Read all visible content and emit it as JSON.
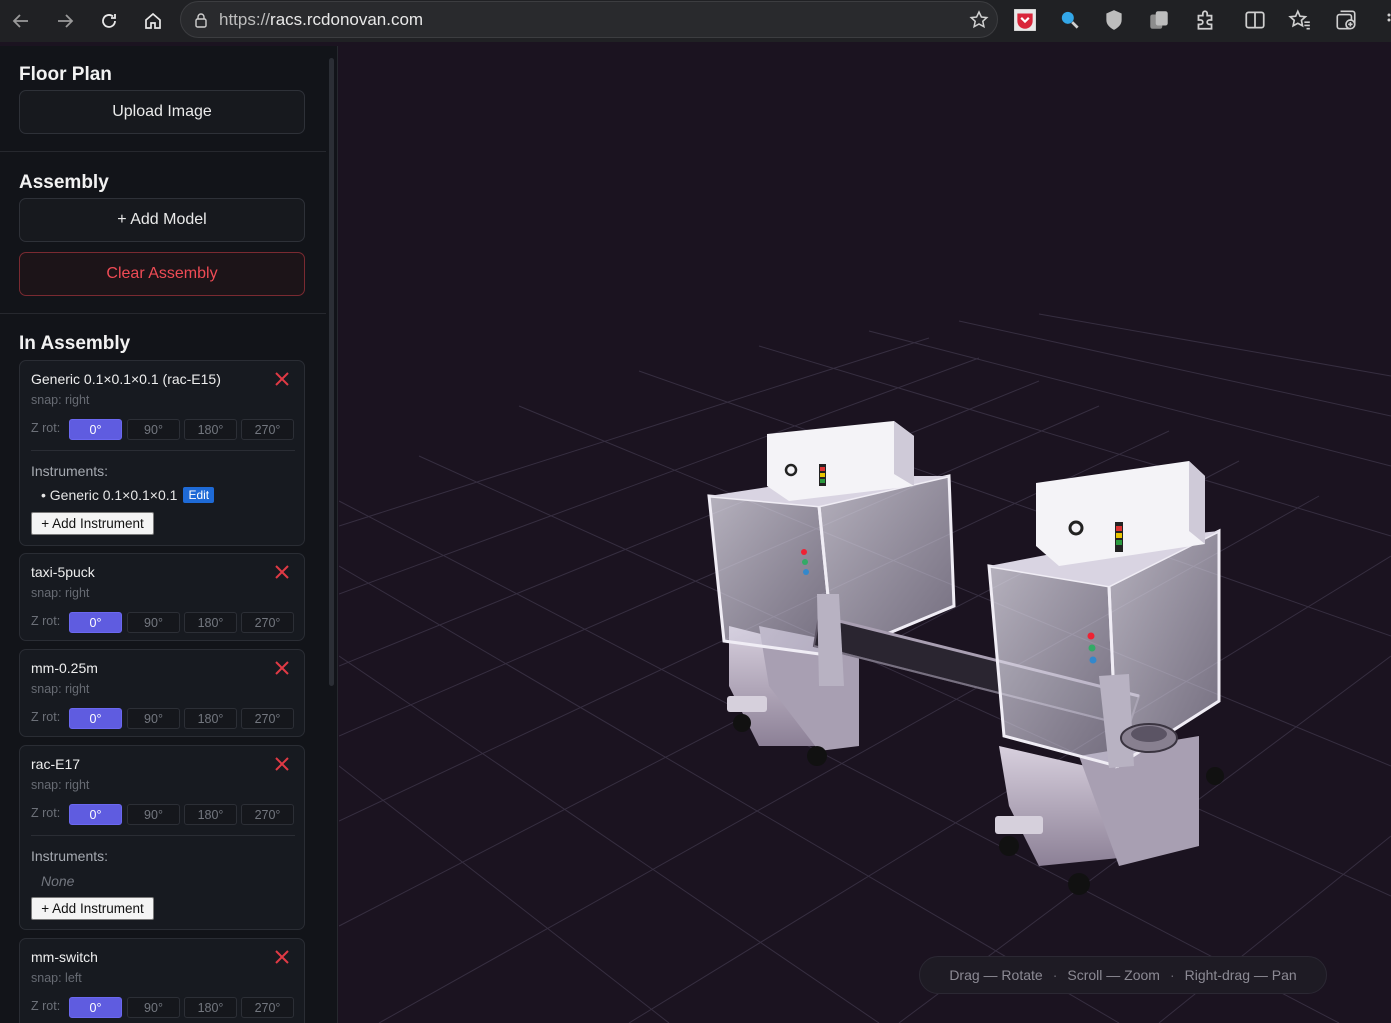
{
  "browser": {
    "url_protocol": "https://",
    "url_host": "racs.rcdonovan.com"
  },
  "sidebar": {
    "floor_plan": {
      "title": "Floor Plan",
      "upload_label": "Upload Image"
    },
    "assembly": {
      "title": "Assembly",
      "add_model_label": "+ Add Model",
      "clear_label": "Clear Assembly"
    },
    "in_assembly": {
      "title": "In Assembly",
      "rot_label": "Z rot:",
      "rot_options": [
        "0°",
        "90°",
        "180°",
        "270°"
      ],
      "instruments_label": "Instruments:",
      "add_instrument_label": "+ Add Instrument",
      "edit_label": "Edit",
      "none_label": "None",
      "items": [
        {
          "name": "Generic 0.1×0.1×0.1 (rac-E15)",
          "snap": "snap: right",
          "rotation": "0°",
          "instruments": [
            "Generic 0.1×0.1×0.1"
          ]
        },
        {
          "name": "taxi-5puck",
          "snap": "snap: right",
          "rotation": "0°"
        },
        {
          "name": "mm-0.25m",
          "snap": "snap: right",
          "rotation": "0°"
        },
        {
          "name": "rac-E17",
          "snap": "snap: right",
          "rotation": "0°",
          "instruments": []
        },
        {
          "name": "mm-switch",
          "snap": "snap: left",
          "rotation": "0°"
        }
      ]
    }
  },
  "viewport": {
    "hints": [
      "Drag — Rotate",
      "Scroll — Zoom",
      "Right-drag — Pan"
    ],
    "colors": {
      "background": "#1b1320",
      "grid": "#3a3344",
      "cabinet": "#e8e8ee",
      "frame": "#c9c2d4"
    }
  }
}
